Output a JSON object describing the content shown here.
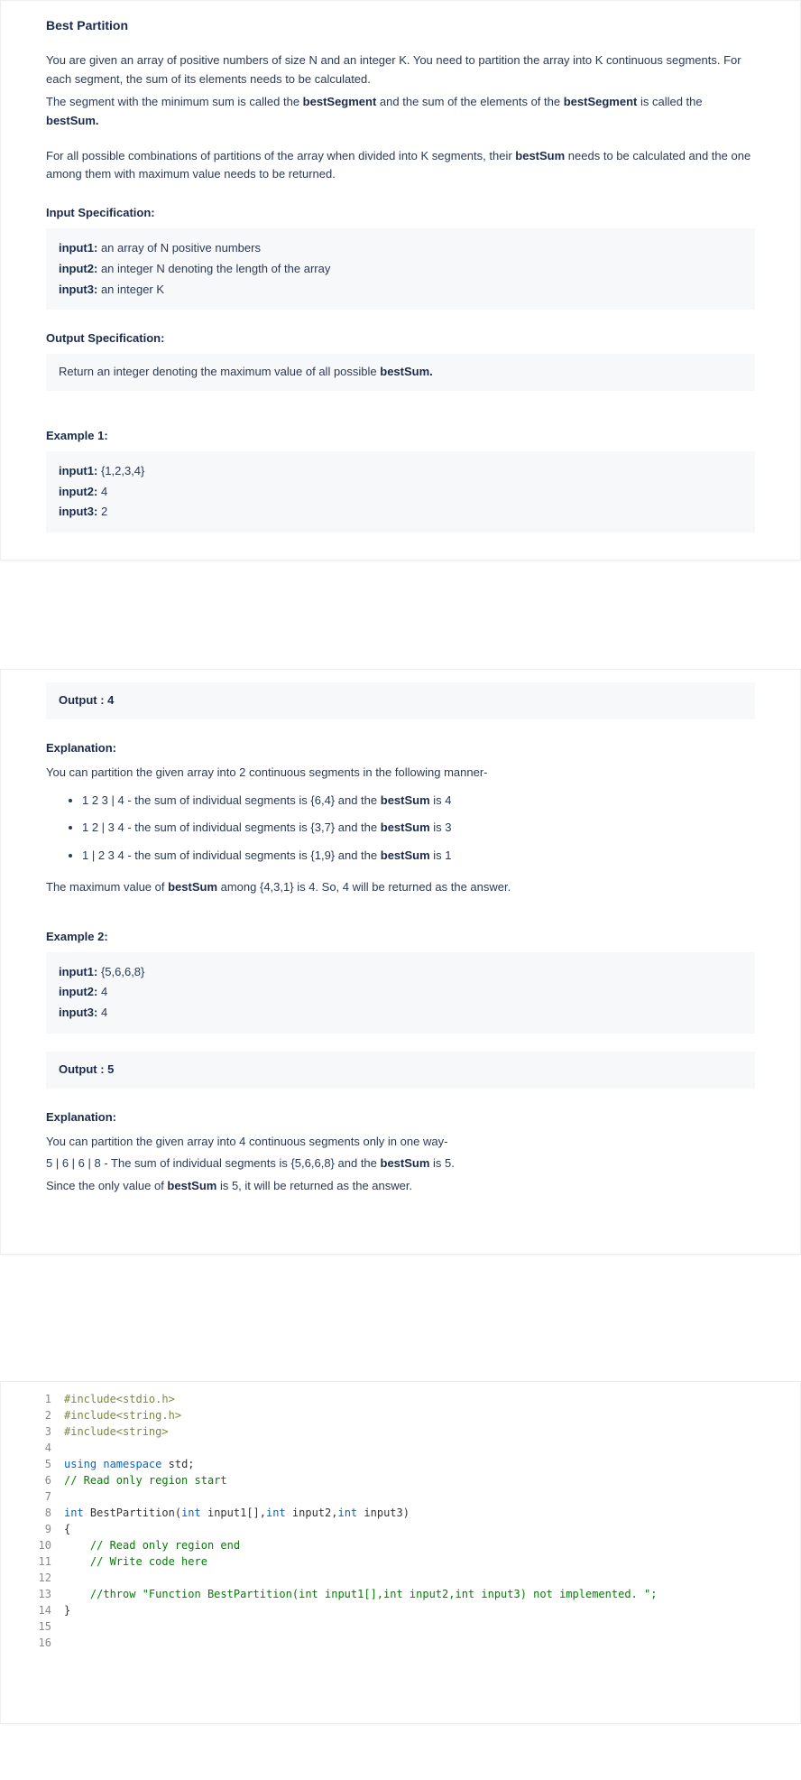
{
  "problem": {
    "title": "Best Partition",
    "intro_p1_a": "You are given an array of positive numbers of size N and an integer K. You need to partition the array into K continuous segments. For each segment, the sum of its elements needs to be calculated.",
    "intro_p1_b_pre": "The segment with the minimum sum is called the ",
    "intro_p1_b_bold1": "bestSegment",
    "intro_p1_b_mid": " and the sum of the elements of the ",
    "intro_p1_b_bold2": "bestSegment",
    "intro_p1_b_mid2": " is called the ",
    "intro_p1_b_bold3": "bestSum.",
    "intro_p2_pre": "For all possible combinations of partitions of the array when divided into K segments, their ",
    "intro_p2_bold": "bestSum",
    "intro_p2_post": " needs to be calculated and the one among them with maximum value needs to be returned.",
    "input_spec_head": "Input Specification:",
    "input1_label": "input1:",
    "input1_text": " an array of N positive numbers",
    "input2_label": "input2:",
    "input2_text": " an integer N denoting the length of the array",
    "input3_label": "input3:",
    "input3_text": " an integer K",
    "output_spec_head": "Output Specification:",
    "output_spec_pre": "Return an integer denoting the maximum value of all possible ",
    "output_spec_bold": "bestSum.",
    "example1_head": "Example 1:",
    "ex1_in1_label": "input1:",
    "ex1_in1_val": " {1,2,3,4}",
    "ex1_in2_label": "input2:",
    "ex1_in2_val": " 4",
    "ex1_in3_label": "input3:",
    "ex1_in3_val": " 2"
  },
  "section2": {
    "output_label": "Output : 4",
    "explanation_head": "Explanation:",
    "exp_intro": "You can partition the given array into 2 continuous segments in the following manner-",
    "bullet1_pre": "1 2 3 | 4 - the sum of individual segments is {6,4} and the ",
    "bullet1_bold": "bestSum",
    "bullet1_post": " is 4",
    "bullet2_pre": "1 2 | 3 4 - the sum of individual segments is {3,7} and the ",
    "bullet2_bold": "bestSum",
    "bullet2_post": " is 3",
    "bullet3_pre": "1 | 2 3 4 - the sum of individual segments is {1,9} and the ",
    "bullet3_bold": "bestSum",
    "bullet3_post": " is 1",
    "exp_conc_pre": "The maximum value of ",
    "exp_conc_bold": "bestSum",
    "exp_conc_post": " among {4,3,1} is 4. So, 4 will be returned as the answer.",
    "example2_head": "Example 2:",
    "ex2_in1_label": "input1:",
    "ex2_in1_val": " {5,6,6,8}",
    "ex2_in2_label": "input2:",
    "ex2_in2_val": " 4",
    "ex2_in3_label": "input3:",
    "ex2_in3_val": " 4",
    "output2_label": "Output : 5",
    "explanation2_head": "Explanation:",
    "exp2_l1": "You can partition the given array into 4 continuous segments only in one way-",
    "exp2_l2_pre": "5 | 6 | 6 | 8 - The sum of individual segments is {5,6,6,8} and the ",
    "exp2_l2_bold": "bestSum",
    "exp2_l2_post": " is 5.",
    "exp2_l3_pre": "Since the only value of ",
    "exp2_l3_bold": "bestSum",
    "exp2_l3_post": " is 5, it will be returned as the answer."
  },
  "code": {
    "lines": [
      {
        "n": "1",
        "tokens": [
          {
            "c": "tk-pre",
            "t": "#include<stdio.h>"
          }
        ]
      },
      {
        "n": "2",
        "tokens": [
          {
            "c": "tk-pre",
            "t": "#include<string.h>"
          }
        ]
      },
      {
        "n": "3",
        "tokens": [
          {
            "c": "tk-pre",
            "t": "#include<string>"
          }
        ]
      },
      {
        "n": "4",
        "tokens": []
      },
      {
        "n": "5",
        "tokens": [
          {
            "c": "tk-kw",
            "t": "using"
          },
          {
            "c": "",
            "t": " "
          },
          {
            "c": "tk-kw",
            "t": "namespace"
          },
          {
            "c": "",
            "t": " std;"
          }
        ]
      },
      {
        "n": "6",
        "tokens": [
          {
            "c": "tk-cm",
            "t": "// Read only region start"
          }
        ]
      },
      {
        "n": "7",
        "tokens": []
      },
      {
        "n": "8",
        "tokens": [
          {
            "c": "tk-type",
            "t": "int"
          },
          {
            "c": "",
            "t": " BestPartition("
          },
          {
            "c": "tk-type",
            "t": "int"
          },
          {
            "c": "",
            "t": " input1[],"
          },
          {
            "c": "tk-type",
            "t": "int"
          },
          {
            "c": "",
            "t": " input2,"
          },
          {
            "c": "tk-type",
            "t": "int"
          },
          {
            "c": "",
            "t": " input3)"
          }
        ]
      },
      {
        "n": "9",
        "tokens": [
          {
            "c": "",
            "t": "{"
          }
        ]
      },
      {
        "n": "10",
        "tokens": [
          {
            "c": "",
            "t": "    "
          },
          {
            "c": "tk-cm",
            "t": "// Read only region end"
          }
        ]
      },
      {
        "n": "11",
        "tokens": [
          {
            "c": "",
            "t": "    "
          },
          {
            "c": "tk-cm",
            "t": "// Write code here"
          }
        ]
      },
      {
        "n": "12",
        "tokens": []
      },
      {
        "n": "13",
        "tokens": [
          {
            "c": "",
            "t": "    "
          },
          {
            "c": "tk-cm",
            "t": "//throw \"Function BestPartition(int input1[],int input2,int input3) not implemented. \";"
          }
        ]
      },
      {
        "n": "14",
        "tokens": [
          {
            "c": "",
            "t": "}"
          }
        ]
      },
      {
        "n": "15",
        "tokens": []
      },
      {
        "n": "16",
        "tokens": []
      }
    ]
  }
}
